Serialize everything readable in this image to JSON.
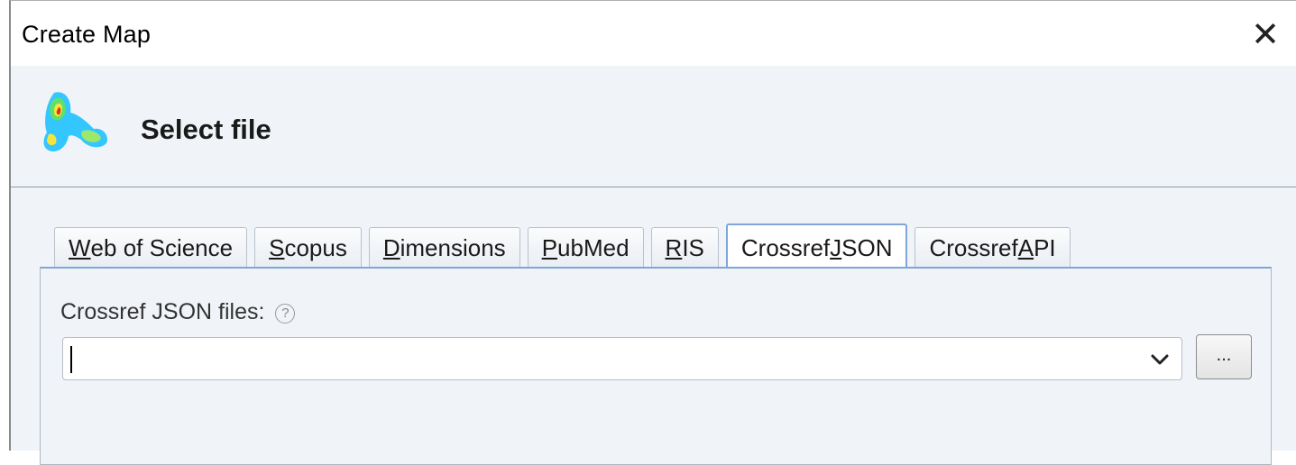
{
  "window": {
    "title": "Create Map"
  },
  "header": {
    "title": "Select file",
    "logo_icon": "vosviewer-logo-icon"
  },
  "tabs": [
    {
      "before": "",
      "mnemonic": "W",
      "after": "eb of Science"
    },
    {
      "before": "",
      "mnemonic": "S",
      "after": "copus"
    },
    {
      "before": "",
      "mnemonic": "D",
      "after": "imensions"
    },
    {
      "before": "",
      "mnemonic": "P",
      "after": "ubMed"
    },
    {
      "before": "",
      "mnemonic": "R",
      "after": "IS"
    },
    {
      "before": "Crossref ",
      "mnemonic": "J",
      "after": "SON"
    },
    {
      "before": "Crossref ",
      "mnemonic": "A",
      "after": "PI"
    }
  ],
  "active_tab_index": 5,
  "panel": {
    "field_label": "Crossref JSON files:",
    "help_symbol": "?",
    "input_value": "",
    "browse_label": "..."
  },
  "colors": {
    "accent": "#7ea6d9",
    "background": "#f0f4f9"
  }
}
